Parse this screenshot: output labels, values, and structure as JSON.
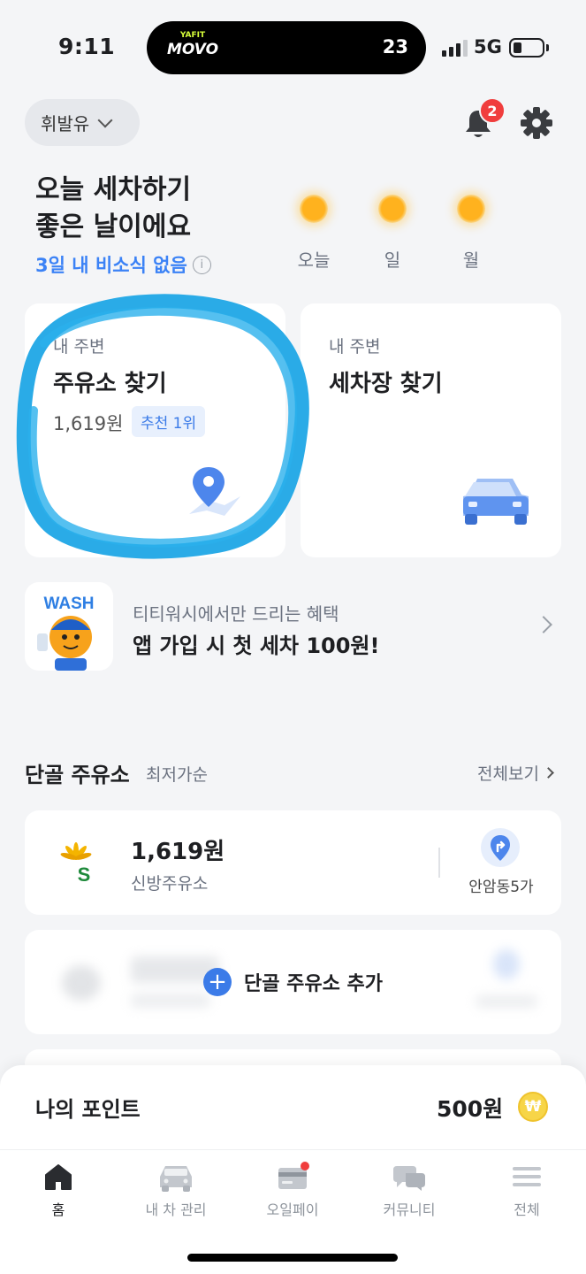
{
  "status_bar": {
    "time": "9:11",
    "island_logo_top": "YAFIT",
    "island_logo": "MOVO",
    "island_number": "23",
    "network": "5G"
  },
  "header": {
    "fuel_type": "휘발유",
    "notification_count": "2"
  },
  "headline": {
    "line1": "오늘 세차하기",
    "line2": "좋은 날이에요",
    "no_rain": "3일 내 비소식 없음",
    "info_glyph": "i"
  },
  "weather": [
    {
      "label": "오늘",
      "icon": "sun-icon"
    },
    {
      "label": "일",
      "icon": "sun-icon"
    },
    {
      "label": "월",
      "icon": "sun-icon"
    }
  ],
  "cards": {
    "gas": {
      "subtitle": "내 주변",
      "title": "주유소 찾기",
      "price": "1,619원",
      "badge": "추천 1위",
      "icon": "map-pin-icon"
    },
    "wash": {
      "subtitle": "내 주변",
      "title": "세차장 찾기",
      "icon": "car-icon"
    }
  },
  "promo": {
    "logo_text": "WASH",
    "subtitle": "티티워시에서만 드리는 혜택",
    "title": "앱 가입 시 첫 세차 100원!"
  },
  "favorites": {
    "title": "단골 주유소",
    "sort": "최저가순",
    "see_all": "전체보기",
    "stations": [
      {
        "price": "1,619원",
        "name": "신방주유소",
        "area": "안암동5가",
        "logo": "s-oil-logo",
        "nav_icon": "directions-icon"
      }
    ],
    "add_label": "단골 주유소 추가"
  },
  "points": {
    "label": "나의 포인트",
    "value": "500원",
    "coin_symbol": "₩"
  },
  "tabs": [
    {
      "label": "홈",
      "icon": "home-icon",
      "active": true
    },
    {
      "label": "내 차 관리",
      "icon": "car-icon",
      "active": false
    },
    {
      "label": "오일페이",
      "icon": "card-icon",
      "active": false
    },
    {
      "label": "커뮤니티",
      "icon": "chat-icon",
      "active": false
    },
    {
      "label": "전체",
      "icon": "menu-icon",
      "active": false
    }
  ],
  "colors": {
    "accent_blue": "#3b7be8",
    "badge_red": "#f03d3d",
    "highlight_stroke": "#1fa7e6",
    "background": "#f4f5f7"
  }
}
